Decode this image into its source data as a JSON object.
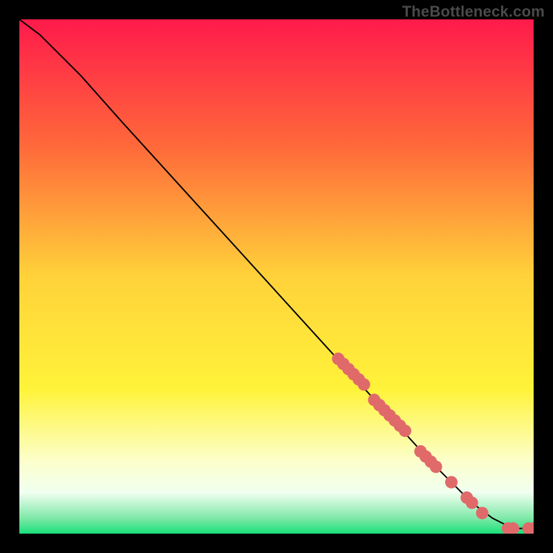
{
  "watermark": "TheBottleneck.com",
  "chart_data": {
    "type": "line",
    "title": "",
    "xlabel": "",
    "ylabel": "",
    "xlim": [
      0,
      100
    ],
    "ylim": [
      0,
      100
    ],
    "grid": false,
    "legend": false,
    "gradient_stops": [
      {
        "offset": 0.0,
        "color": "#ff1a4b"
      },
      {
        "offset": 0.25,
        "color": "#ff6a3a"
      },
      {
        "offset": 0.5,
        "color": "#ffd23a"
      },
      {
        "offset": 0.72,
        "color": "#fff33a"
      },
      {
        "offset": 0.86,
        "color": "#fcffcc"
      },
      {
        "offset": 0.92,
        "color": "#f0fff0"
      },
      {
        "offset": 0.97,
        "color": "#7fe8a8"
      },
      {
        "offset": 1.0,
        "color": "#19e07a"
      }
    ],
    "series": [
      {
        "name": "curve",
        "type": "line",
        "color": "#000000",
        "x": [
          0,
          4,
          8,
          12,
          20,
          30,
          40,
          50,
          60,
          70,
          80,
          88,
          92,
          94,
          96,
          98,
          100
        ],
        "y": [
          100,
          97,
          93,
          89,
          80,
          69,
          58,
          47,
          36,
          25,
          14,
          6,
          3,
          2,
          1,
          1,
          1
        ]
      },
      {
        "name": "markers",
        "type": "scatter",
        "color": "#e06a6a",
        "radius": 9,
        "points": [
          {
            "x": 62,
            "y": 34
          },
          {
            "x": 63,
            "y": 33
          },
          {
            "x": 64,
            "y": 32
          },
          {
            "x": 65,
            "y": 31
          },
          {
            "x": 66,
            "y": 30
          },
          {
            "x": 67,
            "y": 29
          },
          {
            "x": 69,
            "y": 26
          },
          {
            "x": 70,
            "y": 25
          },
          {
            "x": 71,
            "y": 24
          },
          {
            "x": 72,
            "y": 23
          },
          {
            "x": 73,
            "y": 22
          },
          {
            "x": 74,
            "y": 21
          },
          {
            "x": 75,
            "y": 20
          },
          {
            "x": 78,
            "y": 16
          },
          {
            "x": 79,
            "y": 15
          },
          {
            "x": 80,
            "y": 14
          },
          {
            "x": 81,
            "y": 13
          },
          {
            "x": 84,
            "y": 10
          },
          {
            "x": 87,
            "y": 7
          },
          {
            "x": 88,
            "y": 6
          },
          {
            "x": 90,
            "y": 4
          },
          {
            "x": 95,
            "y": 1
          },
          {
            "x": 96,
            "y": 1
          },
          {
            "x": 99,
            "y": 1
          },
          {
            "x": 100,
            "y": 1
          }
        ]
      }
    ]
  }
}
